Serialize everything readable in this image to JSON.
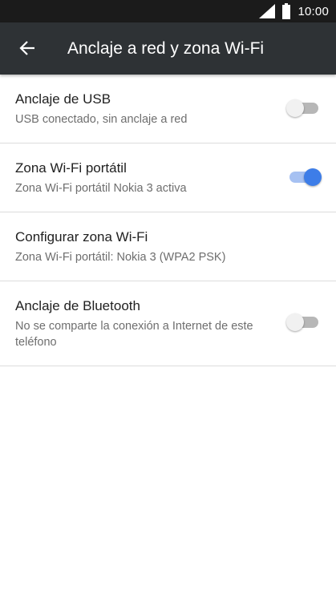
{
  "status_bar": {
    "time": "10:00",
    "icons": [
      "signal-icon",
      "battery-icon"
    ]
  },
  "app_bar": {
    "back_icon": "arrow-back-icon",
    "title": "Anclaje a red y zona Wi-Fi"
  },
  "settings": {
    "items": [
      {
        "title": "Anclaje de USB",
        "summary": "USB conectado, sin anclaje a red",
        "toggle": false
      },
      {
        "title": "Zona Wi-Fi portátil",
        "summary": "Zona Wi-Fi portátil Nokia 3 activa",
        "toggle": true
      },
      {
        "title": "Configurar zona Wi-Fi",
        "summary": "Zona Wi-Fi portátil: Nokia 3 (WPA2 PSK)"
      },
      {
        "title": "Anclaje de Bluetooth",
        "summary": "No se comparte la conexión a Internet de este teléfono",
        "toggle": false
      }
    ]
  },
  "colors": {
    "status_bar": "#1b1b1b",
    "app_bar": "#2e3235",
    "accent": "#3d7de8",
    "divider": "#dcdcdc"
  }
}
